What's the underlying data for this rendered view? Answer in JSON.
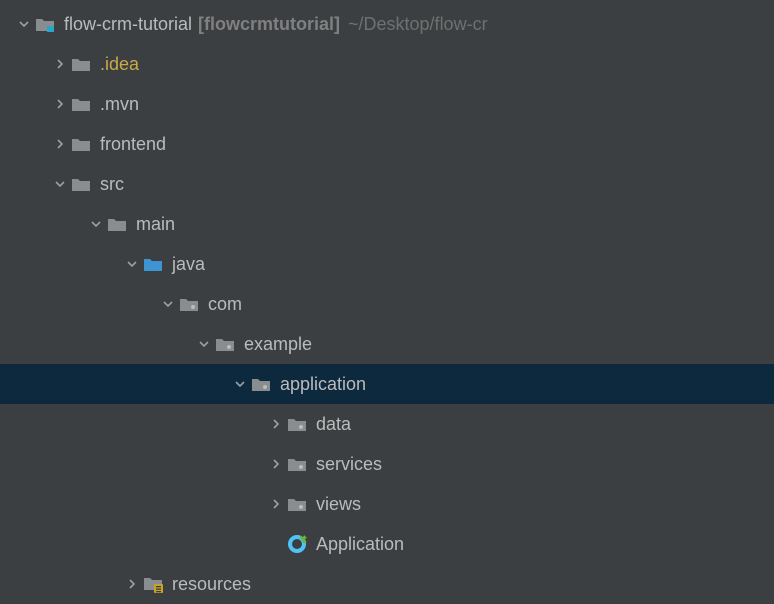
{
  "tree": {
    "root": {
      "name": "flow-crm-tutorial",
      "module": "[flowcrmtutorial]",
      "path": "~/Desktop/flow-cr"
    },
    "idea": ".idea",
    "mvn": ".mvn",
    "frontend": "frontend",
    "src": "src",
    "main": "main",
    "java": "java",
    "com": "com",
    "example": "example",
    "application": "application",
    "data": "data",
    "services": "services",
    "views": "views",
    "app_class": "Application",
    "resources": "resources"
  },
  "colors": {
    "folder_gray": "#8a8d8f",
    "folder_blue": "#3d94d1",
    "folder_yellow": "#9e8a4a",
    "arrow": "#9aa0a3",
    "spring_green": "#6db33f",
    "spring_blue": "#4fc3f7"
  }
}
